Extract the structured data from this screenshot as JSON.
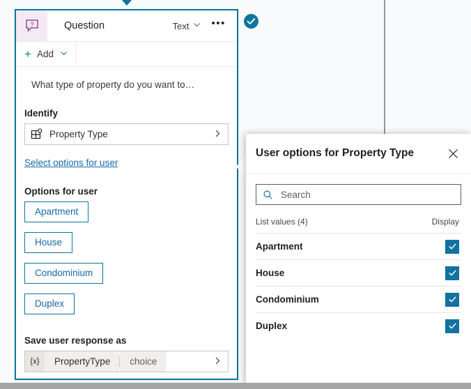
{
  "canvas": {
    "connector_label": "flow-connector"
  },
  "card": {
    "icon": "question-bubble-icon",
    "title": "Question",
    "type_label": "Text",
    "type_chevron": "chevron-down-icon",
    "more_label": "•••",
    "toolbar": {
      "plus": "+",
      "add_label": "Add",
      "add_chevron": "chevron-down-icon"
    },
    "question_text": "What type of property do you want to…",
    "identify": {
      "label": "Identify",
      "icon": "entity-grid-icon",
      "value": "Property Type",
      "chevron": "chevron-right-icon"
    },
    "select_options_link": "Select options for user",
    "options": {
      "label": "Options for user",
      "items": [
        "Apartment",
        "House",
        "Condominium",
        "Duplex"
      ]
    },
    "save_response": {
      "label": "Save user response as",
      "badge": "{x}",
      "variable_name": "PropertyType",
      "variable_type": "choice",
      "chevron": "chevron-right-icon"
    },
    "status_badge": "check-circle-icon"
  },
  "panel": {
    "title": "User options for Property Type",
    "close_icon": "close-icon",
    "search": {
      "icon": "search-icon",
      "placeholder": "Search",
      "value": ""
    },
    "list_header": {
      "values_label": "List values (4)",
      "display_label": "Display"
    },
    "rows": [
      {
        "name": "Apartment",
        "checked": true
      },
      {
        "name": "House",
        "checked": true
      },
      {
        "name": "Condominium",
        "checked": true
      },
      {
        "name": "Duplex",
        "checked": true
      }
    ]
  },
  "colors": {
    "accent": "#0b7699",
    "link": "#1569a8",
    "checkbox": "#1272a1",
    "icon_purple": "#8a2e8a",
    "icon_bg": "#f4eaf4",
    "card_border": "#0b7699",
    "connector": "#979797"
  }
}
